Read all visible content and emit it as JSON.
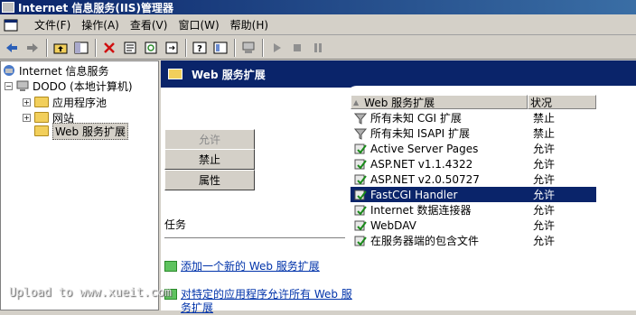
{
  "window": {
    "title": "Internet 信息服务(IIS)管理器"
  },
  "menu": [
    {
      "label": "文件(F)"
    },
    {
      "label": "操作(A)"
    },
    {
      "label": "查看(V)"
    },
    {
      "label": "窗口(W)"
    },
    {
      "label": "帮助(H)"
    }
  ],
  "toolbar": {
    "icons": [
      "back-icon",
      "forward-icon",
      "up-folder-icon",
      "show-hide-tree-icon",
      "delete-icon",
      "properties-icon",
      "refresh-icon",
      "export-icon",
      "help-icon",
      "console-tree-icon",
      "computer-icon",
      "play-icon",
      "stop-icon",
      "pause-icon"
    ]
  },
  "tree": {
    "root": "Internet 信息服务",
    "computer": "DODO (本地计算机)",
    "items": [
      "应用程序池",
      "网站",
      "Web 服务扩展"
    ]
  },
  "panel": {
    "header": "Web 服务扩展",
    "buttons": {
      "allow": "允许",
      "prohibit": "禁止",
      "properties": "属性"
    },
    "tasks_label": "任务",
    "tasks": [
      "添加一个新的 Web 服务扩展",
      "对特定的应用程序允许所有 Web 服务扩展"
    ]
  },
  "list": {
    "columns": [
      "Web 服务扩展",
      "状况"
    ],
    "sort_indicator": "▲",
    "rows": [
      {
        "name": "所有未知 CGI 扩展",
        "status": "禁止",
        "icon": "filter-icon"
      },
      {
        "name": "所有未知 ISAPI 扩展",
        "status": "禁止",
        "icon": "filter-icon"
      },
      {
        "name": "Active Server Pages",
        "status": "允许",
        "icon": "extension-allowed-icon"
      },
      {
        "name": "ASP.NET v1.1.4322",
        "status": "允许",
        "icon": "extension-allowed-icon"
      },
      {
        "name": "ASP.NET v2.0.50727",
        "status": "允许",
        "icon": "extension-allowed-icon"
      },
      {
        "name": "FastCGI Handler",
        "status": "允许",
        "icon": "extension-allowed-icon"
      },
      {
        "name": "Internet 数据连接器",
        "status": "允许",
        "icon": "extension-allowed-icon"
      },
      {
        "name": "WebDAV",
        "status": "允许",
        "icon": "extension-allowed-icon"
      },
      {
        "name": "在服务器端的包含文件",
        "status": "允许",
        "icon": "extension-allowed-icon"
      }
    ],
    "selected_index": 5
  },
  "watermark": "Upload to www.xueit.com"
}
